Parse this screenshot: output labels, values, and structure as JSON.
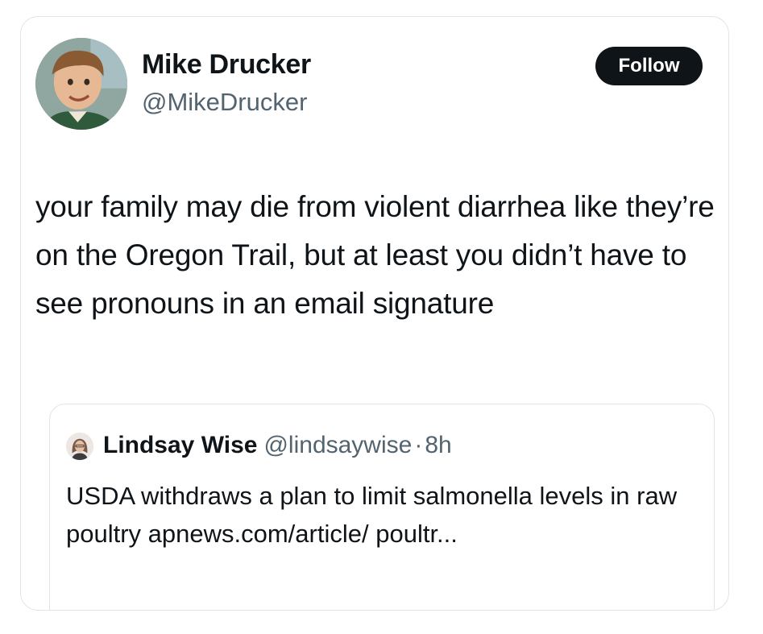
{
  "tweet": {
    "author_name": "Mike Drucker",
    "author_handle": "@MikeDrucker",
    "follow_label": "Follow",
    "text": "your family may die from violent diarrhea like they’re on the Oregon Trail, but at least you didn’t have to see pronouns in an email signature"
  },
  "quoted_tweet": {
    "author_name": "Lindsay Wise",
    "author_handle": "@lindsaywise",
    "separator": "·",
    "time": "8h",
    "text": "USDA withdraws a plan to limit salmonella levels in raw poultry apnews.com/article/ poultr..."
  },
  "colors": {
    "follow_button_bg": "#0f1419",
    "secondary_text": "#536471",
    "border": "#e1e5e8"
  },
  "icons": {
    "author_avatar": "avatar",
    "quoted_author_avatar": "avatar"
  }
}
